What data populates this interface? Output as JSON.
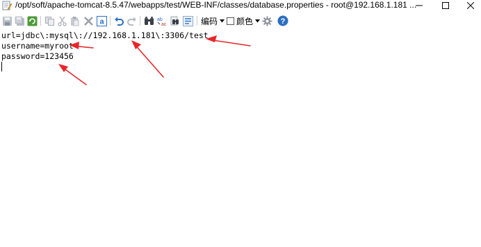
{
  "window": {
    "title": "/opt/soft/apache-tomcat-8.5.47/webapps/test/WEB-INF/classes/database.properties - root@192.168.1.181 ...",
    "controls": {
      "minimize": "—",
      "maximize": "☐",
      "close": "✕"
    }
  },
  "toolbar": {
    "encoding_label": "编码",
    "color_label": "颜色",
    "icons": [
      "save-icon",
      "save-all-icon",
      "reload-icon",
      "copy-icon",
      "cut-icon",
      "paste-icon",
      "delete-icon",
      "select-all-icon",
      "undo-icon",
      "redo-icon",
      "find-icon",
      "replace-icon",
      "find-in-files-icon",
      "word-wrap-icon",
      "encoding-icon",
      "color-icon",
      "settings-icon",
      "help-icon"
    ]
  },
  "editor": {
    "lines": [
      "url=jdbc\\:mysql\\://192.168.1.181\\:3306/test",
      "username=myroot",
      "password=123456"
    ]
  },
  "annotations": {
    "arrow_color": "#e8262a"
  }
}
